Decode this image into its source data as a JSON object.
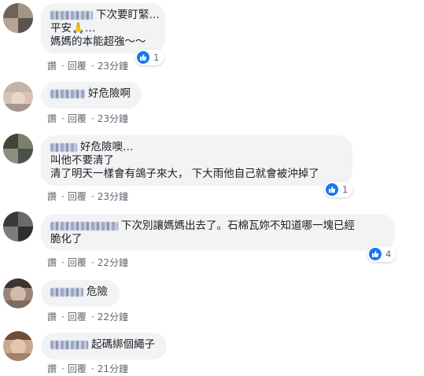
{
  "comments": [
    {
      "lines": [
        "下次要盯緊…",
        "平安🙏…",
        "媽媽的本能超強～～"
      ],
      "actions": {
        "like": "讚",
        "reply": "回覆",
        "time": "23分鐘"
      },
      "reactions": "1"
    },
    {
      "lines": [
        "好危險啊"
      ],
      "actions": {
        "like": "讚",
        "reply": "回覆",
        "time": "23分鐘"
      }
    },
    {
      "lines": [
        "好危險噢…",
        "叫他不要清了",
        "清了明天一樣會有鴿子來大， 下大雨他自己就會被沖掉了"
      ],
      "actions": {
        "like": "讚",
        "reply": "回覆",
        "time": "23分鐘"
      },
      "reactions": "1"
    },
    {
      "lines": [
        "下次別讓媽媽出去了。石棉瓦妳不知道哪一塊已經",
        "脆化了"
      ],
      "actions": {
        "like": "讚",
        "reply": "回覆",
        "time": "22分鐘"
      },
      "reactions": "4"
    },
    {
      "lines": [
        "危險"
      ],
      "actions": {
        "like": "讚",
        "reply": "回覆",
        "time": "22分鐘"
      }
    },
    {
      "lines": [
        "起碼綁個繩子"
      ],
      "actions": {
        "like": "讚",
        "reply": "回覆",
        "time": "21分鐘"
      }
    }
  ],
  "icons": {
    "reaction": "like-icon"
  },
  "colors": {
    "like": "#1877f2",
    "bubble": "#f2f3f5",
    "meta": "#606770"
  }
}
